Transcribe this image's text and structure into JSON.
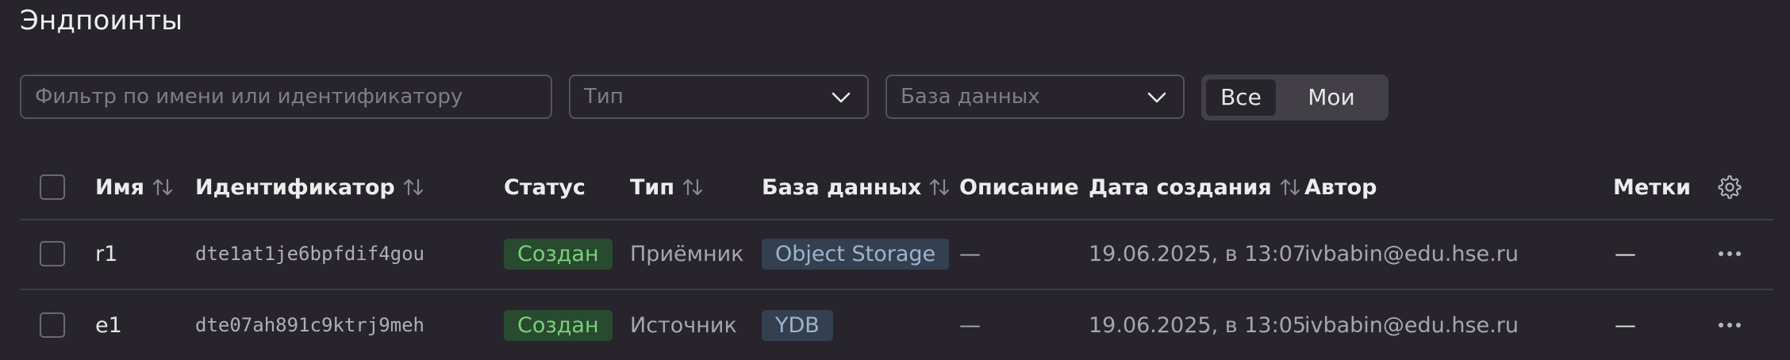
{
  "page": {
    "title": "Эндпоинты"
  },
  "filters": {
    "search_placeholder": "Фильтр по имени или идентификатору",
    "type_placeholder": "Тип",
    "db_placeholder": "База данных",
    "segment": {
      "all": "Все",
      "mine": "Мои",
      "selected": "all"
    }
  },
  "table": {
    "headers": {
      "name": "Имя",
      "id": "Идентификатор",
      "status": "Статус",
      "type": "Тип",
      "db": "База данных",
      "description": "Описание",
      "created": "Дата создания",
      "author": "Автор",
      "labels": "Метки"
    },
    "rows": [
      {
        "name": "r1",
        "id": "dte1at1je6bpfdif4gou",
        "status": "Создан",
        "type": "Приёмник",
        "db": "Object Storage",
        "description": "—",
        "created": "19.06.2025, в 13:07",
        "author": "ivbabin@edu.hse.ru",
        "labels": "—"
      },
      {
        "name": "e1",
        "id": "dte07ah891c9ktrj9meh",
        "status": "Создан",
        "type": "Источник",
        "db": "YDB",
        "description": "—",
        "created": "19.06.2025, в 13:05",
        "author": "ivbabin@edu.hse.ru",
        "labels": "—"
      }
    ]
  },
  "colors": {
    "background": "#27252b",
    "status_ok_bg": "#284a2e",
    "status_ok_text": "#7bd07d",
    "db_badge_bg": "#34404f",
    "db_badge_text": "#9cb4cf"
  },
  "icons": [
    "chevron-down-icon",
    "sort-icon",
    "gear-icon",
    "more-icon"
  ]
}
